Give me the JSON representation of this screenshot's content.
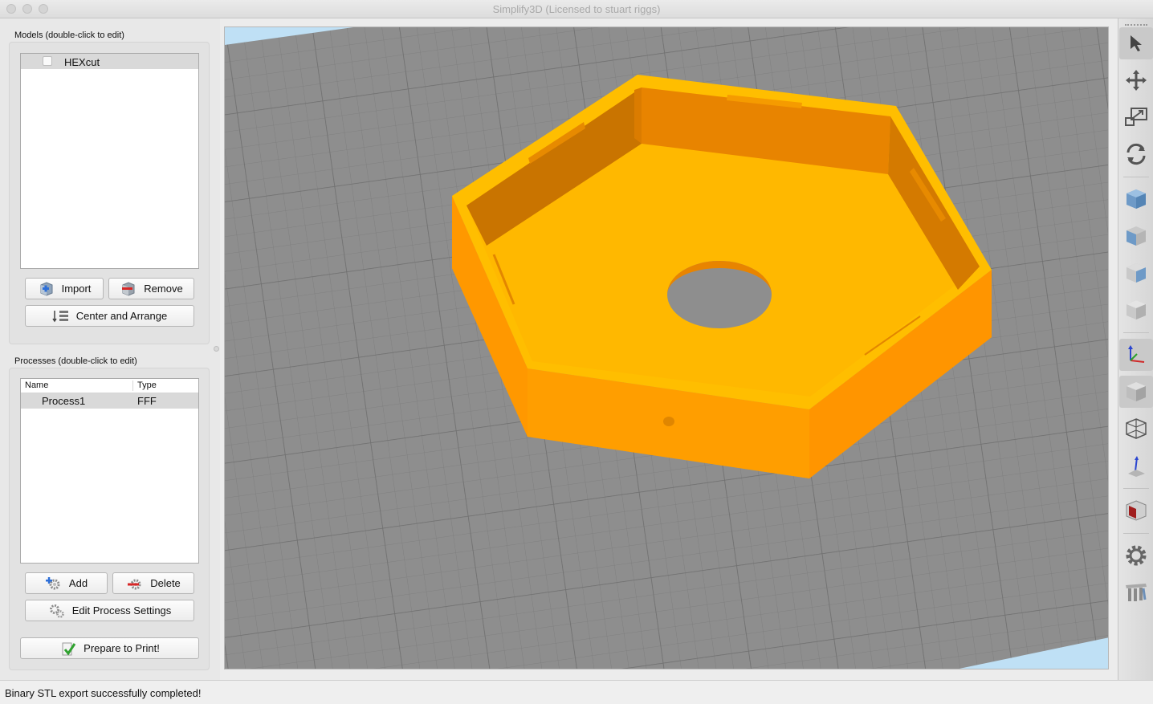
{
  "window": {
    "title": "Simplify3D (Licensed to stuart riggs)"
  },
  "models": {
    "label": "Models (double-click to edit)",
    "items": [
      {
        "name": "HEXcut",
        "checked": false
      }
    ],
    "import_label": "Import",
    "remove_label": "Remove",
    "center_label": "Center and Arrange"
  },
  "processes": {
    "label": "Processes (double-click to edit)",
    "columns": {
      "name": "Name",
      "type": "Type"
    },
    "rows": [
      {
        "name": "Process1",
        "type": "FFF"
      }
    ],
    "add_label": "Add",
    "delete_label": "Delete",
    "edit_label": "Edit Process Settings",
    "prepare_label": "Prepare to Print!"
  },
  "toolbar": {
    "tools": [
      "select-icon",
      "move-icon",
      "scale-icon",
      "rotate-icon",
      "view-iso-icon",
      "view-front-icon",
      "view-top-icon",
      "view-side-icon",
      "axes-icon",
      "solid-view-icon",
      "wireframe-icon",
      "build-volume-icon",
      "cross-section-icon",
      "settings-gear-icon",
      "support-icon"
    ]
  },
  "viewport": {
    "model_name": "HEXcut",
    "model_color": "#FFB800",
    "model_shade": "#E88400",
    "bed_color": "#8E8E8E",
    "bed_background": "#BFE0F5"
  },
  "status": {
    "message": "Binary STL export successfully completed!"
  }
}
